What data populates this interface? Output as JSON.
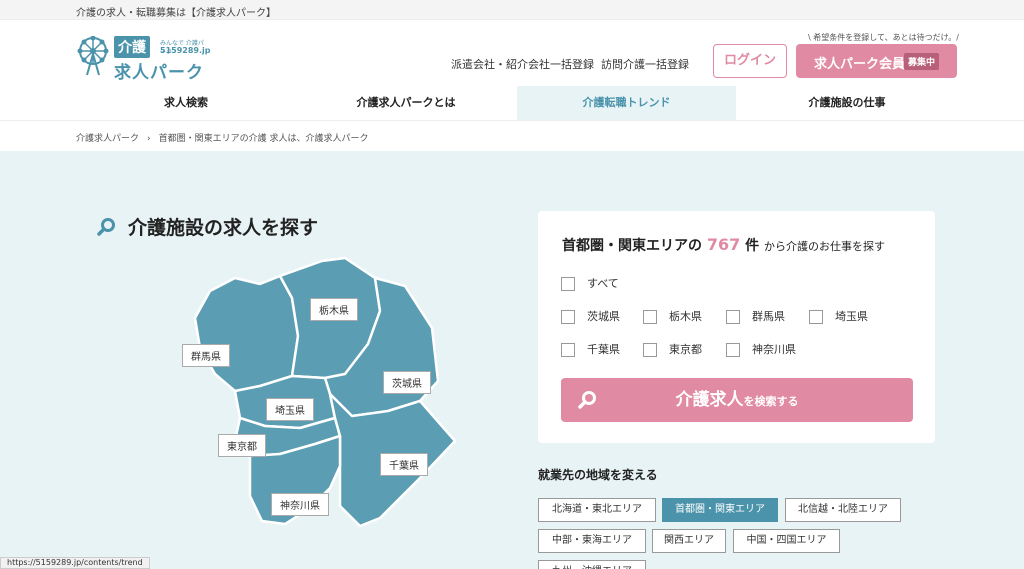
{
  "topline": "介護の求人・転職募集は【介護求人パーク】",
  "logo": {
    "kaigo": "介護",
    "small": "みんなで 介護パーク",
    "url": "5159289.jp",
    "main": "求人パーク"
  },
  "header": {
    "links": [
      "派遣会社・紹介会社一括登録",
      "訪問介護一括登録"
    ],
    "tagline": "\\ 希望条件を登録して、あとは待つだけ。/",
    "login_label": "ログイン",
    "member_label": "求人パーク会員",
    "member_badge": "募集中"
  },
  "nav": [
    "求人検索",
    "介護求人パークとは",
    "介護転職トレンド",
    "介護施設の仕事"
  ],
  "breadcrumb": [
    "介護求人パーク",
    "首都圏・関東エリアの介護 求人は、介護求人パーク"
  ],
  "section_title": "介護施設の求人を探す",
  "map": {
    "labels": [
      "栃木県",
      "群馬県",
      "茨城県",
      "埼玉県",
      "東京都",
      "千葉県",
      "神奈川県"
    ],
    "color": "#5b9db2"
  },
  "panel": {
    "area": "首都圏・関東エリアの",
    "count": "767",
    "unit": "件",
    "suffix": "から介護のお仕事を探す",
    "checkboxes": [
      "すべて",
      "茨城県",
      "栃木県",
      "群馬県",
      "埼玉県",
      "千葉県",
      "東京都",
      "神奈川県"
    ],
    "search_main": "介護求人",
    "search_sub": "を検索する"
  },
  "regions": {
    "title": "就業先の地域を変える",
    "items": [
      "北海道・東北エリア",
      "首都圏・関東エリア",
      "北信越・北陸エリア",
      "中部・東海エリア",
      "関西エリア",
      "中国・四国エリア",
      "九州・沖縄エリア"
    ],
    "active_index": 1
  },
  "status_url": "https://5159289.jp/contents/trend",
  "colors": {
    "accent": "#4a93ab",
    "pink": "#e08aa3",
    "bg": "#e8f3f6"
  }
}
